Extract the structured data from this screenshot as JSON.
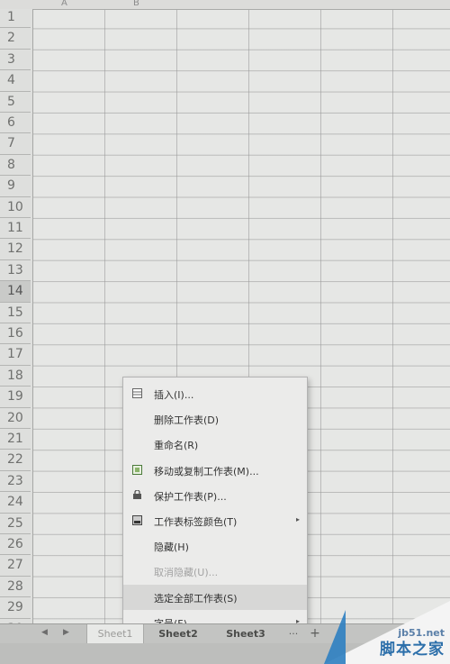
{
  "columns": [
    "A",
    "B"
  ],
  "rows": [
    "1",
    "2",
    "3",
    "4",
    "5",
    "6",
    "7",
    "8",
    "9",
    "10",
    "11",
    "12",
    "13",
    "14",
    "15",
    "16",
    "17",
    "18",
    "19",
    "20",
    "21",
    "22",
    "23",
    "24",
    "25",
    "26",
    "27",
    "28",
    "29",
    "30"
  ],
  "active_row": "14",
  "context_menu": {
    "items": [
      {
        "label": "插入(I)...",
        "icon": "insert-sheet-icon",
        "disabled": false,
        "submenu": false
      },
      {
        "label": "删除工作表(D)",
        "icon": "",
        "disabled": false,
        "submenu": false
      },
      {
        "label": "重命名(R)",
        "icon": "",
        "disabled": false,
        "submenu": false
      },
      {
        "label": "移动或复制工作表(M)...",
        "icon": "move-copy-icon",
        "disabled": false,
        "submenu": false
      },
      {
        "label": "保护工作表(P)...",
        "icon": "protect-sheet-icon",
        "disabled": false,
        "submenu": false
      },
      {
        "label": "工作表标签颜色(T)",
        "icon": "tab-color-icon",
        "disabled": false,
        "submenu": true
      },
      {
        "label": "隐藏(H)",
        "icon": "",
        "disabled": false,
        "submenu": false
      },
      {
        "label": "取消隐藏(U)...",
        "icon": "",
        "disabled": true,
        "submenu": false
      },
      {
        "label": "选定全部工作表(S)",
        "icon": "",
        "disabled": false,
        "submenu": false
      },
      {
        "label": "字号(F)",
        "icon": "",
        "disabled": false,
        "submenu": true
      }
    ],
    "submenu_arrow": "▸"
  },
  "tabs": [
    "Sheet1",
    "Sheet2",
    "Sheet3"
  ],
  "tab_overflow": "···",
  "add_sheet": "+",
  "watermark": {
    "url": "jb51.net",
    "name": "脚本之家"
  },
  "colors": {
    "accent": "#2c6faa"
  }
}
